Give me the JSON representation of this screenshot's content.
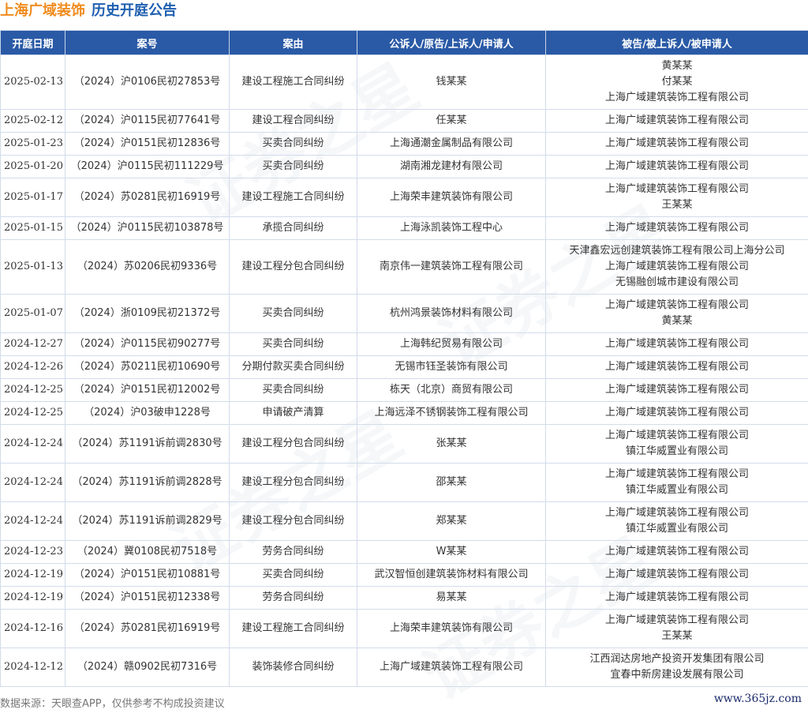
{
  "header": {
    "company": "上海广域装饰",
    "subtitle": "历史开庭公告"
  },
  "columns": [
    "开庭日期",
    "案号",
    "案由",
    "公诉人/原告/上诉人/申请人",
    "被告/被上诉人/被申请人"
  ],
  "rows": [
    {
      "date": "2025-02-13",
      "case_no": "（2024）沪0106民初27853号",
      "cause": "建设工程施工合同纠纷",
      "plaintiff": [
        "钱某某"
      ],
      "defendant": [
        "黄某某",
        "付某某",
        "上海广域建筑装饰工程有限公司"
      ]
    },
    {
      "date": "2025-02-12",
      "case_no": "（2024）沪0115民初77641号",
      "cause": "建设工程合同纠纷",
      "plaintiff": [
        "任某某"
      ],
      "defendant": [
        "上海广域建筑装饰工程有限公司"
      ]
    },
    {
      "date": "2025-01-23",
      "case_no": "（2024）沪0151民初12836号",
      "cause": "买卖合同纠纷",
      "plaintiff": [
        "上海通潮金属制品有限公司"
      ],
      "defendant": [
        "上海广域建筑装饰工程有限公司"
      ]
    },
    {
      "date": "2025-01-20",
      "case_no": "（2024）沪0115民初111229号",
      "cause": "买卖合同纠纷",
      "plaintiff": [
        "湖南湘龙建材有限公司"
      ],
      "defendant": [
        "上海广域建筑装饰工程有限公司"
      ]
    },
    {
      "date": "2025-01-17",
      "case_no": "（2024）苏0281民初16919号",
      "cause": "建设工程施工合同纠纷",
      "plaintiff": [
        "上海荣丰建筑装饰有限公司"
      ],
      "defendant": [
        "上海广域建筑装饰工程有限公司",
        "王某某"
      ]
    },
    {
      "date": "2025-01-15",
      "case_no": "（2024）沪0115民初103878号",
      "cause": "承揽合同纠纷",
      "plaintiff": [
        "上海泳凯装饰工程中心"
      ],
      "defendant": [
        "上海广域建筑装饰工程有限公司"
      ]
    },
    {
      "date": "2025-01-13",
      "case_no": "（2024）苏0206民初9336号",
      "cause": "建设工程分包合同纠纷",
      "plaintiff": [
        "南京伟一建筑装饰工程有限公司"
      ],
      "defendant": [
        "天津鑫宏远创建筑装饰工程有限公司上海分公司",
        "上海广域建筑装饰工程有限公司",
        "无锡融创城市建设有限公司"
      ]
    },
    {
      "date": "2025-01-07",
      "case_no": "（2024）浙0109民初21372号",
      "cause": "买卖合同纠纷",
      "plaintiff": [
        "杭州鸿景装饰材料有限公司"
      ],
      "defendant": [
        "上海广域建筑装饰工程有限公司",
        "黄某某"
      ]
    },
    {
      "date": "2024-12-27",
      "case_no": "（2024）沪0115民初90277号",
      "cause": "买卖合同纠纷",
      "plaintiff": [
        "上海韩纪贸易有限公司"
      ],
      "defendant": [
        "上海广域建筑装饰工程有限公司"
      ]
    },
    {
      "date": "2024-12-26",
      "case_no": "（2024）苏0211民初10690号",
      "cause": "分期付款买卖合同纠纷",
      "plaintiff": [
        "无锡市钰圣装饰有限公司"
      ],
      "defendant": [
        "上海广域建筑装饰工程有限公司"
      ]
    },
    {
      "date": "2024-12-25",
      "case_no": "（2024）沪0151民初12002号",
      "cause": "买卖合同纠纷",
      "plaintiff": [
        "栋天（北京）商贸有限公司"
      ],
      "defendant": [
        "上海广域建筑装饰工程有限公司"
      ]
    },
    {
      "date": "2024-12-25",
      "case_no": "（2024）沪03破申1228号",
      "cause": "申请破产清算",
      "plaintiff": [
        "上海远泽不锈钢装饰工程有限公司"
      ],
      "defendant": [
        "上海广域建筑装饰工程有限公司"
      ]
    },
    {
      "date": "2024-12-24",
      "case_no": "（2024）苏1191诉前调2830号",
      "cause": "建设工程分包合同纠纷",
      "plaintiff": [
        "张某某"
      ],
      "defendant": [
        "上海广域建筑装饰工程有限公司",
        "镇江华威置业有限公司"
      ]
    },
    {
      "date": "2024-12-24",
      "case_no": "（2024）苏1191诉前调2828号",
      "cause": "建设工程分包合同纠纷",
      "plaintiff": [
        "邵某某"
      ],
      "defendant": [
        "上海广域建筑装饰工程有限公司",
        "镇江华威置业有限公司"
      ]
    },
    {
      "date": "2024-12-24",
      "case_no": "（2024）苏1191诉前调2829号",
      "cause": "建设工程分包合同纠纷",
      "plaintiff": [
        "郑某某"
      ],
      "defendant": [
        "上海广域建筑装饰工程有限公司",
        "镇江华威置业有限公司"
      ]
    },
    {
      "date": "2024-12-23",
      "case_no": "（2024）冀0108民初7518号",
      "cause": "劳务合同纠纷",
      "plaintiff": [
        "W某某"
      ],
      "defendant": [
        "上海广域建筑装饰工程有限公司"
      ]
    },
    {
      "date": "2024-12-19",
      "case_no": "（2024）沪0151民初10881号",
      "cause": "买卖合同纠纷",
      "plaintiff": [
        "武汉智恒创建筑装饰材料有限公司"
      ],
      "defendant": [
        "上海广域建筑装饰工程有限公司"
      ]
    },
    {
      "date": "2024-12-19",
      "case_no": "（2024）沪0151民初12338号",
      "cause": "劳务合同纠纷",
      "plaintiff": [
        "易某某"
      ],
      "defendant": [
        "上海广域建筑装饰工程有限公司"
      ]
    },
    {
      "date": "2024-12-16",
      "case_no": "（2024）苏0281民初16919号",
      "cause": "建设工程施工合同纠纷",
      "plaintiff": [
        "上海荣丰建筑装饰有限公司"
      ],
      "defendant": [
        "上海广域建筑装饰工程有限公司",
        "王某某"
      ]
    },
    {
      "date": "2024-12-12",
      "case_no": "（2024）赣0902民初7316号",
      "cause": "装饰装修合同纠纷",
      "plaintiff": [
        "上海广域建筑装饰工程有限公司"
      ],
      "defendant": [
        "江西润达房地产投资开发集团有限公司",
        "宜春中新房建设发展有限公司"
      ]
    }
  ],
  "footer": {
    "source": "数据来源：天眼查APP，仅供参考不构成投资建议",
    "site": "www.365jz.com"
  },
  "watermark": "证券之星",
  "colors": {
    "header_bg": "#2a5aa6",
    "company_text": "#f08c1e",
    "subtitle_text": "#1f5fb0",
    "border": "#d3dceb"
  }
}
